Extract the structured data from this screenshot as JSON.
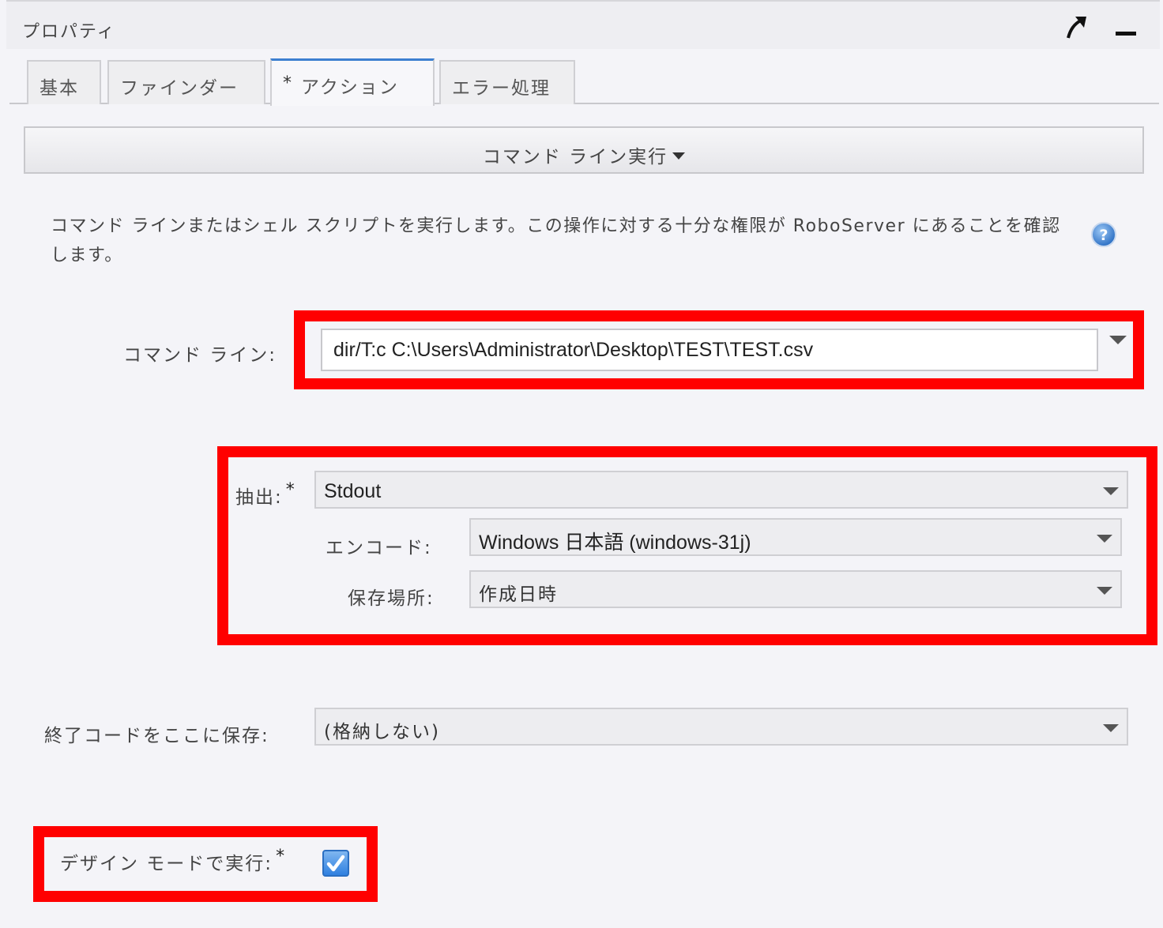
{
  "panel": {
    "title": "プロパティ",
    "icons": {
      "expand": "diagonal-arrow-icon",
      "minimize": "minimize-icon"
    }
  },
  "tabs": [
    {
      "label": "基本",
      "active": false,
      "modified": false
    },
    {
      "label": "ファインダー",
      "active": false,
      "modified": false
    },
    {
      "label": "アクション",
      "active": true,
      "modified": true,
      "modified_marker": "*"
    },
    {
      "label": "エラー処理",
      "active": false,
      "modified": false
    }
  ],
  "action": {
    "label": "コマンド ライン実行"
  },
  "description": {
    "text": "コマンド ラインまたはシェル スクリプトを実行します。この操作に対する十分な権限が RoboServer にあることを確認します。",
    "help_icon": "help-question-icon"
  },
  "form": {
    "command_line": {
      "label": "コマンド ライン:",
      "value": "dir/T:c C:\\Users\\Administrator\\Desktop\\TEST\\TEST.csv"
    },
    "extract": {
      "label": "抽出:",
      "required_marker": "*",
      "value": "Stdout"
    },
    "encoding": {
      "label": "エンコード:",
      "value": "Windows 日本語 (windows-31j)"
    },
    "store_in": {
      "label": "保存場所:",
      "value": "作成日時"
    },
    "exit_code": {
      "label": "終了コードをここに保存:",
      "value": "(格納しない)"
    },
    "design_mode": {
      "label": "デザイン モードで実行:",
      "required_marker": "*",
      "checked": true
    }
  },
  "colors": {
    "highlight": "#ff0000",
    "accent": "#3c7fd0",
    "checkbox": "#2f80e0"
  }
}
